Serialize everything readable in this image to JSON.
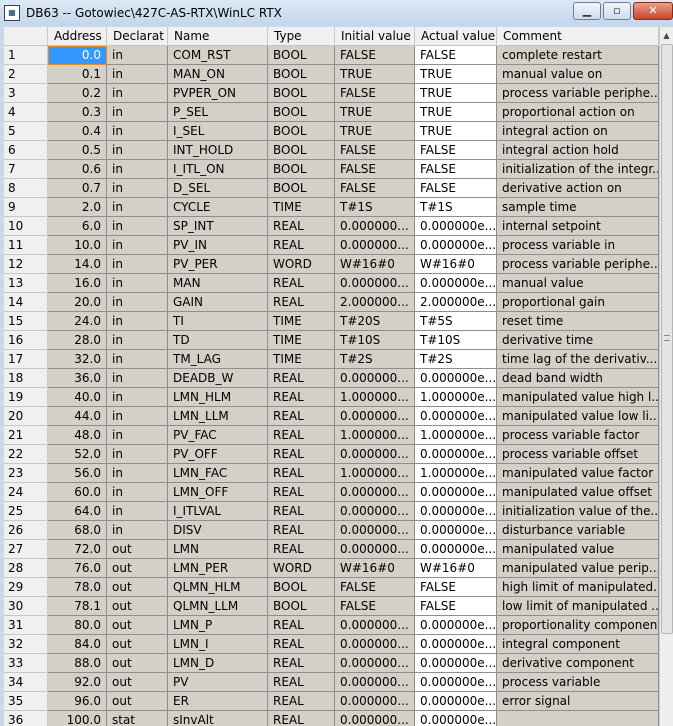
{
  "window": {
    "title": "DB63 -- Gotowiec\\427C-AS-RTX\\WinLC RTX",
    "icon": "db-editor-icon",
    "minimize": "minimize-icon",
    "maximize": "maximize-icon",
    "close": "close-icon"
  },
  "table": {
    "columns": [
      "",
      "Address",
      "Declarat",
      "Name",
      "Type",
      "Initial value",
      "Actual value",
      "Comment"
    ],
    "rows": [
      [
        "1",
        "0.0",
        "in",
        "COM_RST",
        "BOOL",
        "FALSE",
        "FALSE",
        "complete restart"
      ],
      [
        "2",
        "0.1",
        "in",
        "MAN_ON",
        "BOOL",
        "TRUE",
        "TRUE",
        "manual value on"
      ],
      [
        "3",
        "0.2",
        "in",
        "PVPER_ON",
        "BOOL",
        "FALSE",
        "TRUE",
        "process variable periphe..."
      ],
      [
        "4",
        "0.3",
        "in",
        "P_SEL",
        "BOOL",
        "TRUE",
        "TRUE",
        "proportional action on"
      ],
      [
        "5",
        "0.4",
        "in",
        "I_SEL",
        "BOOL",
        "TRUE",
        "TRUE",
        "integral action on"
      ],
      [
        "6",
        "0.5",
        "in",
        "INT_HOLD",
        "BOOL",
        "FALSE",
        "FALSE",
        "integral action hold"
      ],
      [
        "7",
        "0.6",
        "in",
        "I_ITL_ON",
        "BOOL",
        "FALSE",
        "FALSE",
        "initialization of the integr..."
      ],
      [
        "8",
        "0.7",
        "in",
        "D_SEL",
        "BOOL",
        "FALSE",
        "FALSE",
        "derivative action on"
      ],
      [
        "9",
        "2.0",
        "in",
        "CYCLE",
        "TIME",
        "T#1S",
        "T#1S",
        "sample time"
      ],
      [
        "10",
        "6.0",
        "in",
        "SP_INT",
        "REAL",
        "0.000000...",
        "0.000000e...",
        "internal setpoint"
      ],
      [
        "11",
        "10.0",
        "in",
        "PV_IN",
        "REAL",
        "0.000000...",
        "0.000000e...",
        "process variable in"
      ],
      [
        "12",
        "14.0",
        "in",
        "PV_PER",
        "WORD",
        "W#16#0",
        "W#16#0",
        "process variable periphe..."
      ],
      [
        "13",
        "16.0",
        "in",
        "MAN",
        "REAL",
        "0.000000...",
        "0.000000e...",
        "manual value"
      ],
      [
        "14",
        "20.0",
        "in",
        "GAIN",
        "REAL",
        "2.000000...",
        "2.000000e...",
        "proportional gain"
      ],
      [
        "15",
        "24.0",
        "in",
        "TI",
        "TIME",
        "T#20S",
        "T#5S",
        "reset time"
      ],
      [
        "16",
        "28.0",
        "in",
        "TD",
        "TIME",
        "T#10S",
        "T#10S",
        "derivative time"
      ],
      [
        "17",
        "32.0",
        "in",
        "TM_LAG",
        "TIME",
        "T#2S",
        "T#2S",
        "time lag of the derivativ..."
      ],
      [
        "18",
        "36.0",
        "in",
        "DEADB_W",
        "REAL",
        "0.000000...",
        "0.000000e...",
        "dead band width"
      ],
      [
        "19",
        "40.0",
        "in",
        "LMN_HLM",
        "REAL",
        "1.000000...",
        "1.000000e...",
        "manipulated value high l..."
      ],
      [
        "20",
        "44.0",
        "in",
        "LMN_LLM",
        "REAL",
        "0.000000...",
        "0.000000e...",
        "manipulated value low li..."
      ],
      [
        "21",
        "48.0",
        "in",
        "PV_FAC",
        "REAL",
        "1.000000...",
        "1.000000e...",
        "process variable factor"
      ],
      [
        "22",
        "52.0",
        "in",
        "PV_OFF",
        "REAL",
        "0.000000...",
        "0.000000e...",
        "process variable offset"
      ],
      [
        "23",
        "56.0",
        "in",
        "LMN_FAC",
        "REAL",
        "1.000000...",
        "1.000000e...",
        "manipulated value factor"
      ],
      [
        "24",
        "60.0",
        "in",
        "LMN_OFF",
        "REAL",
        "0.000000...",
        "0.000000e...",
        "manipulated value offset"
      ],
      [
        "25",
        "64.0",
        "in",
        "I_ITLVAL",
        "REAL",
        "0.000000...",
        "0.000000e...",
        "initialization value of the..."
      ],
      [
        "26",
        "68.0",
        "in",
        "DISV",
        "REAL",
        "0.000000...",
        "0.000000e...",
        "disturbance variable"
      ],
      [
        "27",
        "72.0",
        "out",
        "LMN",
        "REAL",
        "0.000000...",
        "0.000000e...",
        "manipulated value"
      ],
      [
        "28",
        "76.0",
        "out",
        "LMN_PER",
        "WORD",
        "W#16#0",
        "W#16#0",
        "manipulated value perip..."
      ],
      [
        "29",
        "78.0",
        "out",
        "QLMN_HLM",
        "BOOL",
        "FALSE",
        "FALSE",
        "high limit of manipulated..."
      ],
      [
        "30",
        "78.1",
        "out",
        "QLMN_LLM",
        "BOOL",
        "FALSE",
        "FALSE",
        "low limit of manipulated ..."
      ],
      [
        "31",
        "80.0",
        "out",
        "LMN_P",
        "REAL",
        "0.000000...",
        "0.000000e...",
        "proportionality component"
      ],
      [
        "32",
        "84.0",
        "out",
        "LMN_I",
        "REAL",
        "0.000000...",
        "0.000000e...",
        "integral component"
      ],
      [
        "33",
        "88.0",
        "out",
        "LMN_D",
        "REAL",
        "0.000000...",
        "0.000000e...",
        "derivative component"
      ],
      [
        "34",
        "92.0",
        "out",
        "PV",
        "REAL",
        "0.000000...",
        "0.000000e...",
        "process variable"
      ],
      [
        "35",
        "96.0",
        "out",
        "ER",
        "REAL",
        "0.000000...",
        "0.000000e...",
        "error signal"
      ],
      [
        "36",
        "100.0",
        "stat",
        "sInvAlt",
        "REAL",
        "0.000000...",
        "0.000000e...",
        ""
      ]
    ]
  }
}
